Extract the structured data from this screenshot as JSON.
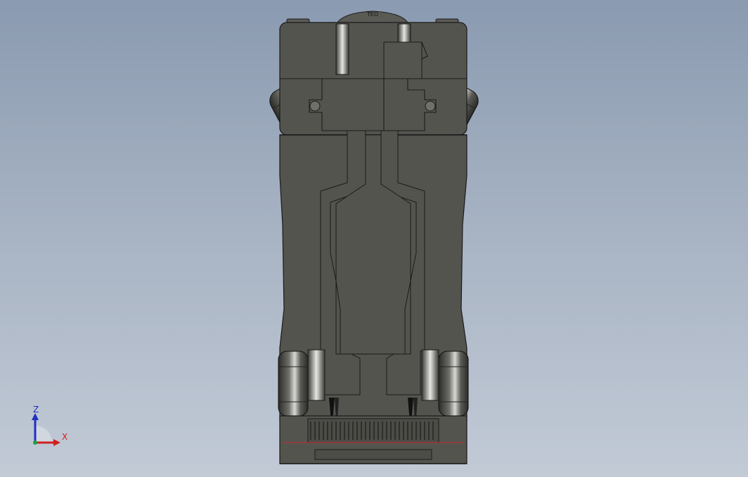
{
  "viewport": {
    "background_top": "#8a9ab0",
    "background_bottom": "#c2cad6"
  },
  "model": {
    "body_color": "#54544f",
    "edge_color": "#1a1a1a",
    "highlight_color": "#8f8f8a",
    "accent_red": "#b03030",
    "top_mark_text": "TEO"
  },
  "triad": {
    "z_label": "Z",
    "x_label": "X",
    "z_color": "#2030c0",
    "x_color": "#d02020",
    "y_color": "#20a040"
  }
}
